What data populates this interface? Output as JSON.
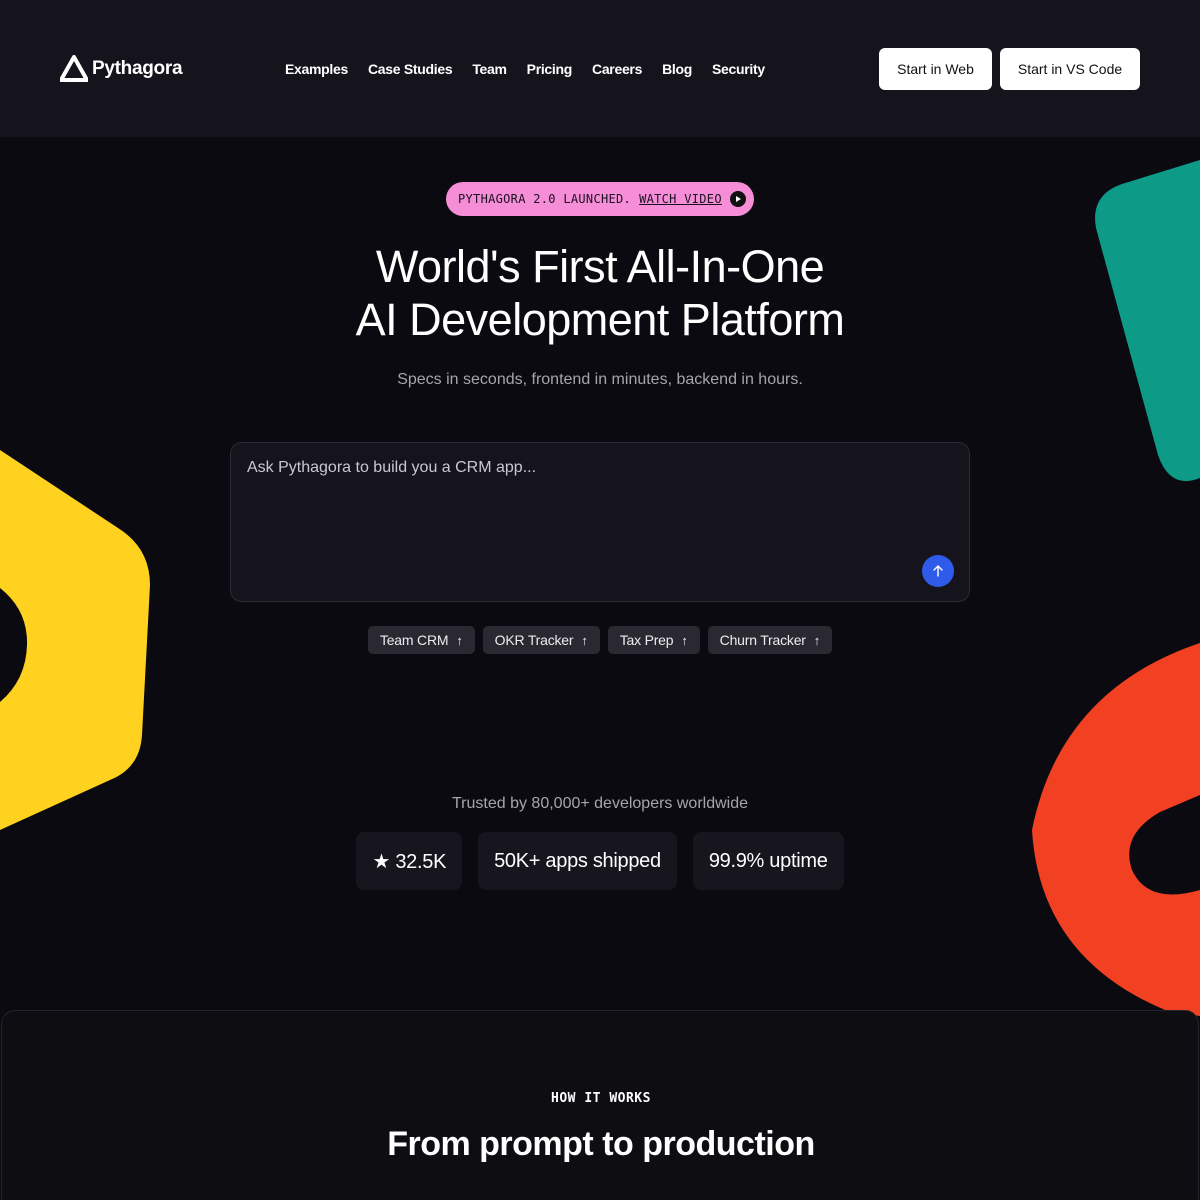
{
  "header": {
    "logo_text": "Pythagora",
    "nav": [
      "Examples",
      "Case Studies",
      "Team",
      "Pricing",
      "Careers",
      "Blog",
      "Security"
    ],
    "btn_web": "Start in Web",
    "btn_vscode": "Start in VS Code"
  },
  "announcement": {
    "text": "PYTHAGORA 2.0 LAUNCHED.",
    "link": "WATCH VIDEO"
  },
  "hero": {
    "title_line1": "World's First All-In-One",
    "title_line2": "AI Development Platform",
    "subtitle": "Specs in seconds, frontend in minutes, backend in hours."
  },
  "prompt": {
    "placeholder": "Ask Pythagora to build you a CRM app..."
  },
  "chips": [
    "Team CRM",
    "OKR Tracker",
    "Tax Prep",
    "Churn Tracker"
  ],
  "trusted": "Trusted by 80,000+ developers worldwide",
  "stats": [
    "★ 32.5K",
    "50K+ apps shipped",
    "99.9% uptime"
  ],
  "how": {
    "eyebrow": "HOW IT WORKS",
    "title": "From prompt to production"
  },
  "colors": {
    "accent_blue": "#2f5bea",
    "pink": "#f58ed7",
    "teal": "#0d9a87",
    "yellow": "#ffd21f",
    "orange": "#f24122"
  }
}
